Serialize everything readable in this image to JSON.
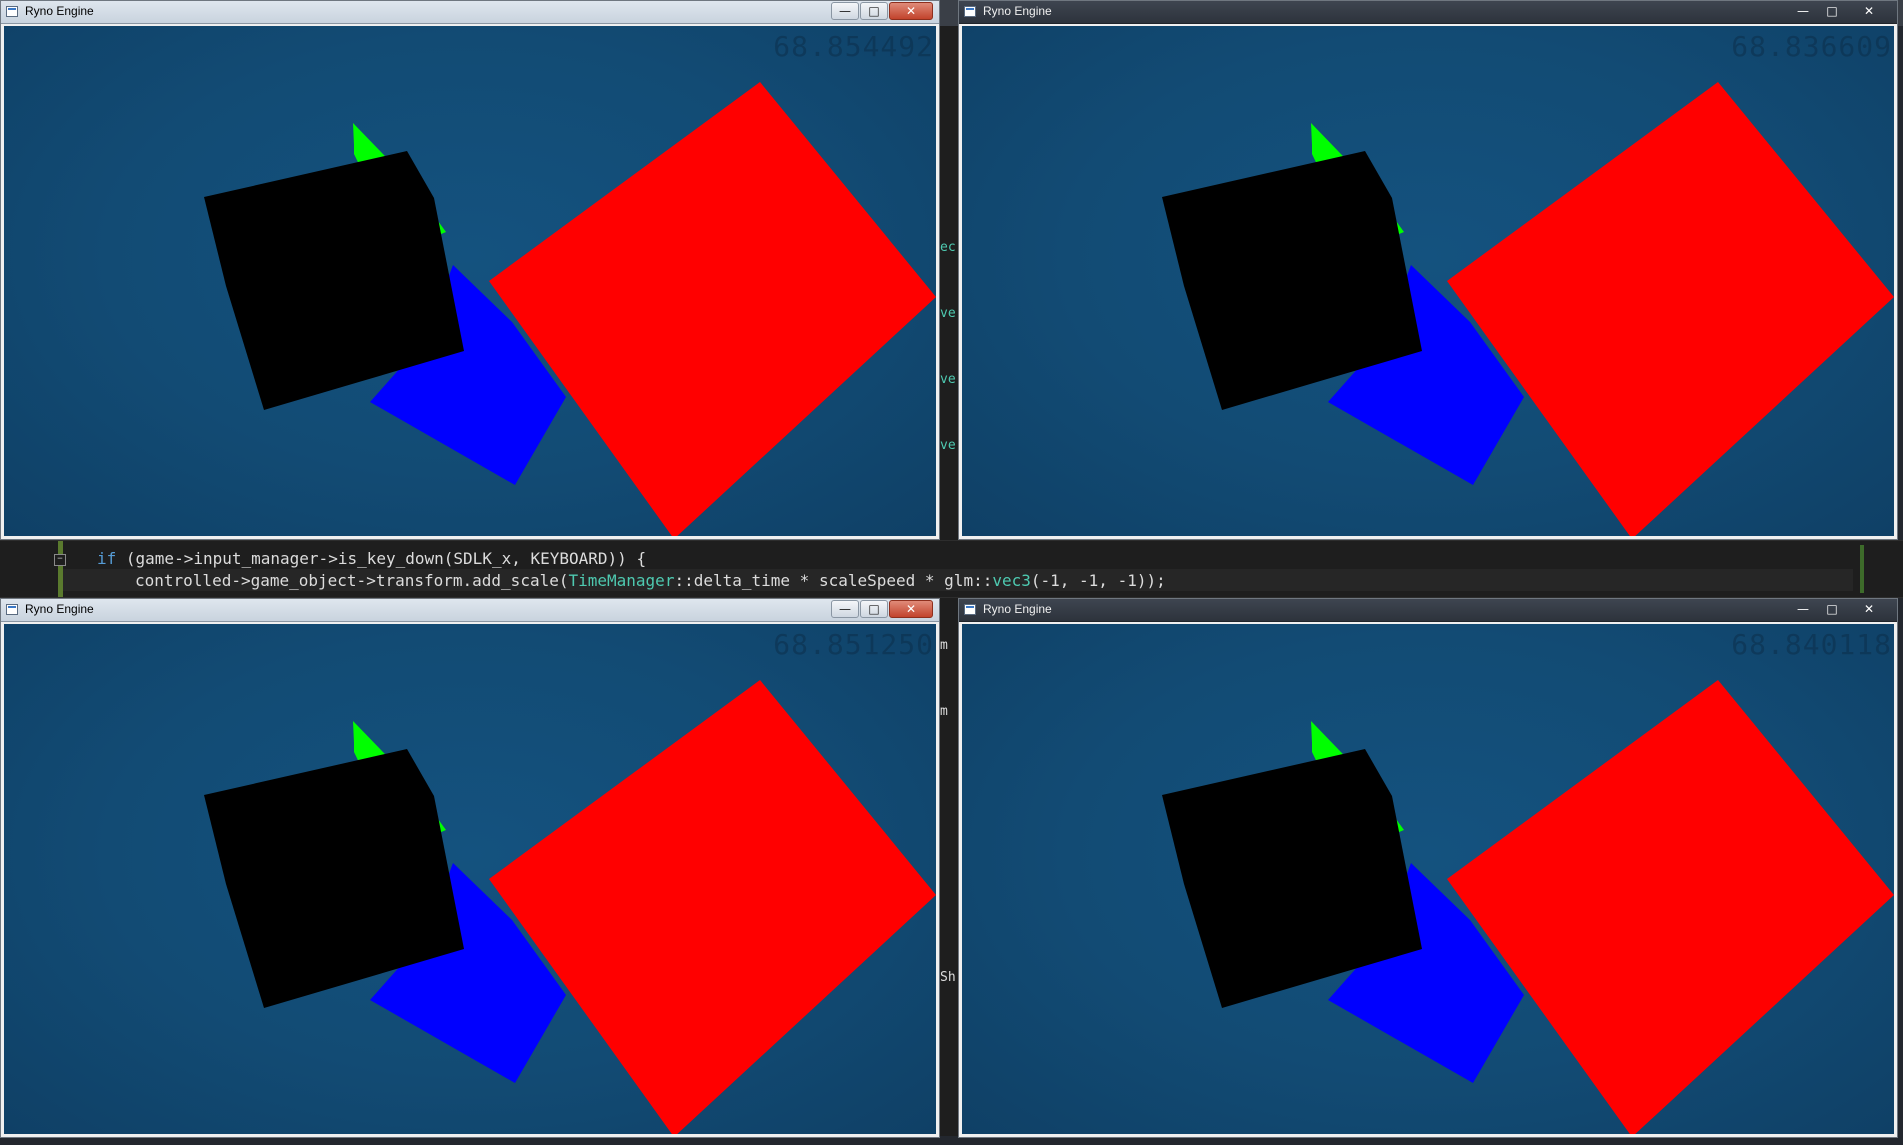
{
  "window_title": "Ryno Engine",
  "colors": {
    "clear": "#124b74",
    "red": "#ff0000",
    "blue": "#0000ff",
    "black": "#000000",
    "green": "#00ff00"
  },
  "windows": [
    {
      "title": "Ryno Engine",
      "fps": "68.854492",
      "controls": [
        "—",
        "□",
        "✕"
      ]
    },
    {
      "title": "Ryno Engine",
      "fps": "68.836609",
      "controls": [
        "—",
        "□",
        "✕"
      ]
    },
    {
      "title": "Ryno Engine",
      "fps": "68.851250",
      "controls": [
        "—",
        "□",
        "✕"
      ]
    },
    {
      "title": "Ryno Engine",
      "fps": "68.840118",
      "controls": [
        "—",
        "□",
        "✕"
      ]
    }
  ],
  "code": {
    "line1": {
      "kw": "if",
      "rest": " (game->input_manager->is_key_down(SDLK_x, KEYBOARD)) {"
    },
    "line2": {
      "a": "controlled->game_object->transform.add_scale(",
      "type": "TimeManager",
      "b": "::delta_time * scaleSpeed * glm::",
      "fn": "vec3",
      "c": "(-1, -1, -1));"
    }
  },
  "ide_fragments": [
    "ec",
    "ve",
    "ve",
    "ve",
    "m",
    "m",
    "Sh"
  ]
}
